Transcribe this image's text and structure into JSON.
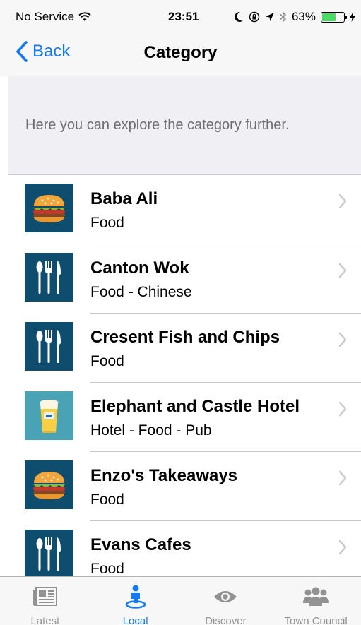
{
  "status_bar": {
    "carrier": "No Service",
    "time": "23:51",
    "battery": "63%",
    "battery_level": 0.63
  },
  "nav": {
    "back_label": "Back",
    "title": "Category"
  },
  "intro": {
    "text": "Here you can explore the category further."
  },
  "items": [
    {
      "title": "Baba Ali",
      "subtitle": "Food",
      "icon": "burger-icon"
    },
    {
      "title": "Canton Wok",
      "subtitle": "Food - Chinese",
      "icon": "cutlery-icon"
    },
    {
      "title": "Cresent Fish and Chips",
      "subtitle": "Food",
      "icon": "cutlery-icon"
    },
    {
      "title": "Elephant and Castle Hotel",
      "subtitle": "Hotel - Food - Pub",
      "icon": "beer-icon"
    },
    {
      "title": "Enzo's Takeaways",
      "subtitle": "Food",
      "icon": "burger-icon"
    },
    {
      "title": "Evans Cafes",
      "subtitle": "Food",
      "icon": "cutlery-icon"
    }
  ],
  "tabs": [
    {
      "label": "Latest",
      "icon": "newspaper-icon",
      "active": false
    },
    {
      "label": "Local",
      "icon": "location-person-icon",
      "active": true
    },
    {
      "label": "Discover",
      "icon": "eye-icon",
      "active": false
    },
    {
      "label": "Town Council",
      "icon": "group-icon",
      "active": false
    }
  ],
  "colors": {
    "accent": "#1479f5",
    "icon_tile_dark": "#0f4d6e",
    "icon_tile_teal": "#4aa3b4",
    "battery": "#4cd964"
  }
}
